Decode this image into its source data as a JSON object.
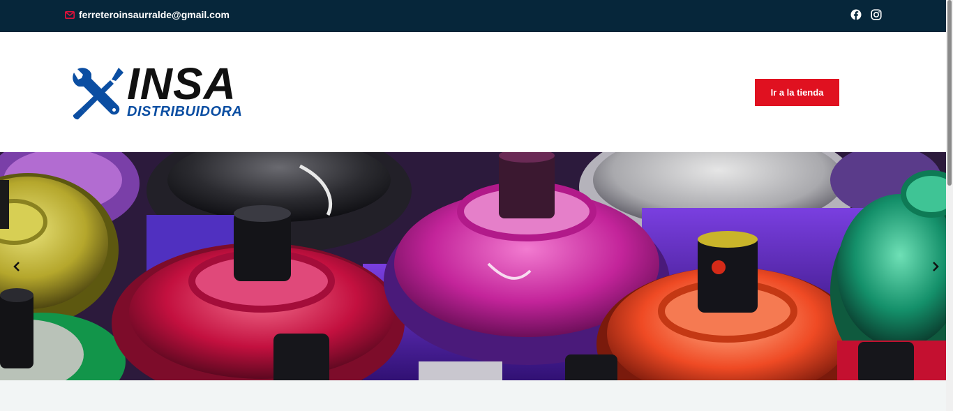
{
  "topbar": {
    "email": "ferreteroinsaurralde@gmail.com",
    "icons": [
      "mail-icon",
      "facebook-icon",
      "instagram-icon"
    ]
  },
  "header": {
    "logo": {
      "brand": "INSA",
      "tagline": "DISTRIBUIDORA",
      "icon": "wrench-screwdriver-icon"
    },
    "cta_label": "Ir a la tienda"
  },
  "slider": {
    "prev_icon": "chevron-left-icon",
    "next_icon": "chevron-right-icon",
    "image": "spray-paint-cans-photo"
  },
  "colors": {
    "topbar_bg": "#06263a",
    "accent_red": "#e01120",
    "brand_blue": "#0b4ea2",
    "brand_black": "#111111",
    "page_bg": "#f2f5f5"
  }
}
